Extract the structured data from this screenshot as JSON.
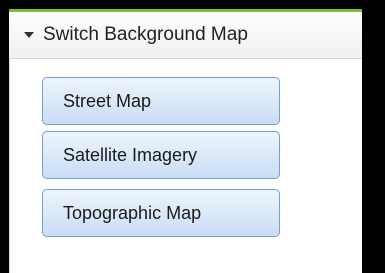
{
  "panel": {
    "title": "Switch Background Map",
    "expanded_icon": "caret-down-icon",
    "accent_color": "#7dbb3a"
  },
  "buttons": [
    {
      "label": "Street Map"
    },
    {
      "label": "Satellite Imagery"
    },
    {
      "label": "Topographic Map"
    }
  ]
}
